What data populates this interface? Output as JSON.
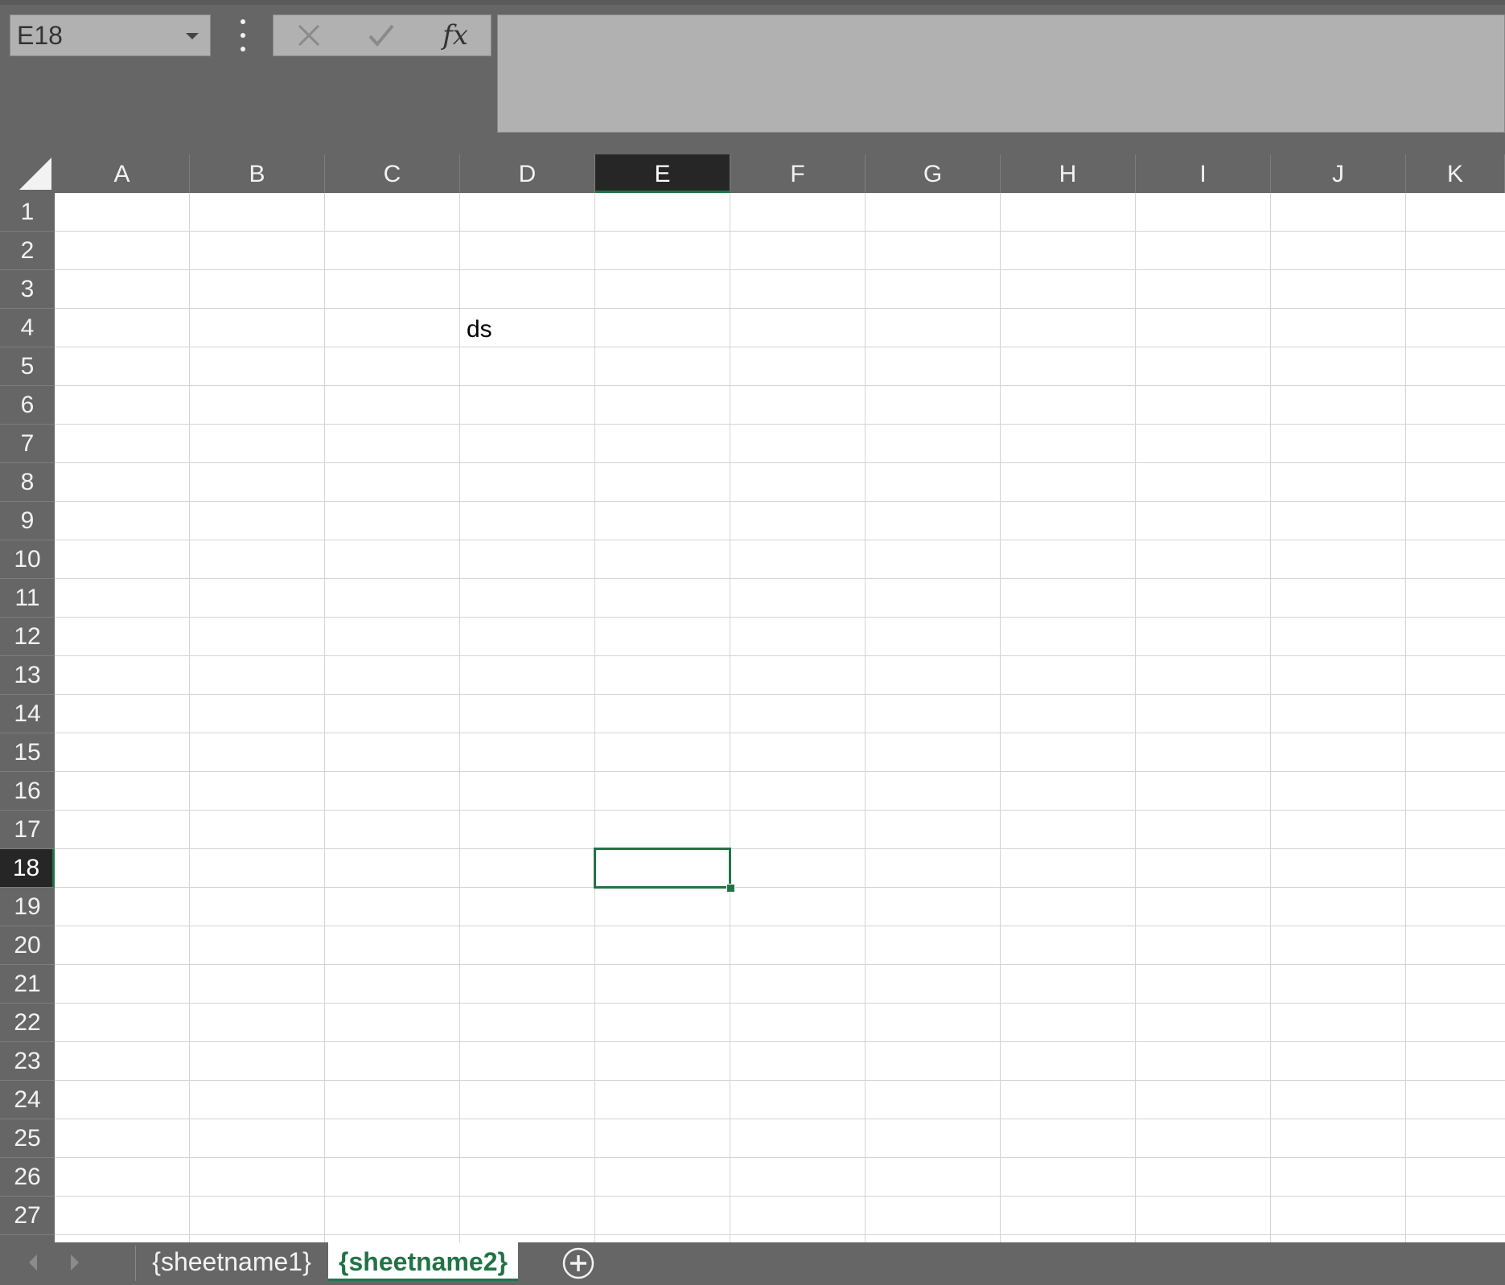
{
  "namebox": {
    "value": "E18"
  },
  "formula_bar": {
    "cancel_icon": "close-icon",
    "enter_icon": "checkmark-icon",
    "fx_label": "fx",
    "value": ""
  },
  "columns": [
    "A",
    "B",
    "C",
    "D",
    "E",
    "F",
    "G",
    "H",
    "I",
    "J",
    "K"
  ],
  "rows": [
    "1",
    "2",
    "3",
    "4",
    "5",
    "6",
    "7",
    "8",
    "9",
    "10",
    "11",
    "12",
    "13",
    "14",
    "15",
    "16",
    "17",
    "18",
    "19",
    "20",
    "21",
    "22",
    "23",
    "24",
    "25",
    "26",
    "27"
  ],
  "active_column": "E",
  "active_row": "18",
  "cells": [
    {
      "ref": "D4",
      "value": "ds"
    }
  ],
  "sheets": [
    {
      "name": "{sheetname1}",
      "active": false
    },
    {
      "name": "{sheetname2}",
      "active": true
    }
  ],
  "colors": {
    "accent": "#217346",
    "chrome": "#666666",
    "input_bg": "#b1b1b1",
    "gridline": "#d4d4d4"
  }
}
